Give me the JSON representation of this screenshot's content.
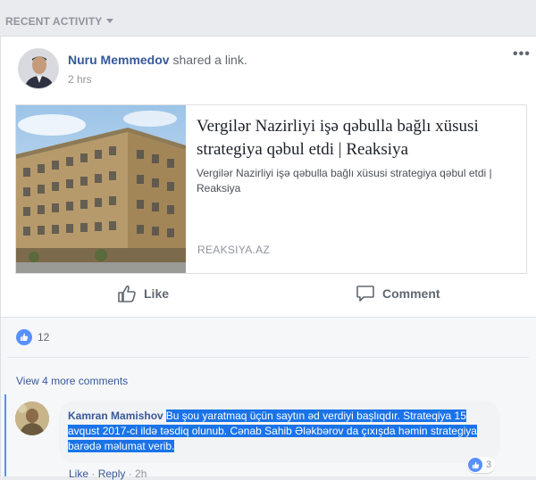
{
  "section": {
    "title": "RECENT ACTIVITY"
  },
  "post": {
    "author": "Nuru Memmedov",
    "action": "shared a link.",
    "time": "2 hrs",
    "more": "•••",
    "link": {
      "title": "Vergilər Nazirliyi işə qəbulla bağlı xüsusi strategiya qəbul etdi | Reaksiya",
      "description": "Vergilər Nazirliyi işə qəbulla bağlı xüsusi strategiya qəbul etdi | Reaksiya",
      "domain": "REAKSIYA.AZ"
    },
    "actions": {
      "like": "Like",
      "comment": "Comment"
    },
    "reaction_count": "12",
    "view_more": "View 4 more comments",
    "comment": {
      "author": "Kamran Mamishov",
      "text": "Bu şou yaratmaq üçün saytın əd verdiyi başlıqdır. Strateqiya 15 avqust 2017-ci ildə təsdiq olunub. Cənab Sahib Ələkbərov da çıxışda həmin strategiya barədə məlumat verib.",
      "reaction_count": "3",
      "meta_like": "Like",
      "meta_reply": "Reply",
      "meta_time": "2h"
    }
  },
  "colors": {
    "accent": "#365899",
    "like_blue": "#5890ff",
    "selection": "#1a73e8",
    "background": "#e9ebee"
  },
  "icons": {
    "like": "thumbs-up-icon",
    "comment": "speech-bubble-icon",
    "caret": "caret-down-icon"
  }
}
